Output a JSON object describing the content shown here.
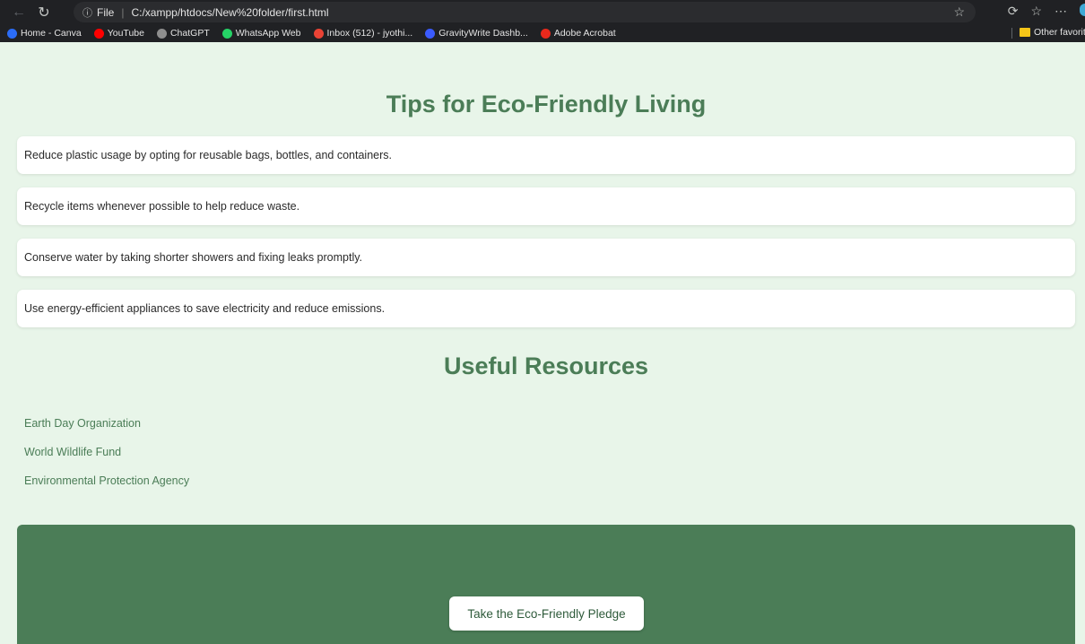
{
  "browser": {
    "file_label": "File",
    "url": "C:/xampp/htdocs/New%20folder/first.html",
    "bookmarks": [
      {
        "label": "Home - Canva",
        "color": "#2b6cf6"
      },
      {
        "label": "YouTube",
        "color": "#ff0000"
      },
      {
        "label": "ChatGPT",
        "color": "#8e8e8e"
      },
      {
        "label": "WhatsApp Web",
        "color": "#25d366"
      },
      {
        "label": "Inbox (512) - jyothi...",
        "color": "#ea4335"
      },
      {
        "label": "GravityWrite Dashb...",
        "color": "#3b5bfd"
      },
      {
        "label": "Adobe Acrobat",
        "color": "#e8291c"
      }
    ],
    "other_favorites": "Other favorit"
  },
  "page": {
    "title": "Tips for Eco-Friendly Living",
    "tips": [
      "Reduce plastic usage by opting for reusable bags, bottles, and containers.",
      "Recycle items whenever possible to help reduce waste.",
      "Conserve water by taking shorter showers and fixing leaks promptly.",
      "Use energy-efficient appliances to save electricity and reduce emissions."
    ],
    "resources_title": "Useful Resources",
    "resources": [
      "Earth Day Organization",
      "World Wildlife Fund",
      "Environmental Protection Agency"
    ],
    "pledge_button": "Take the Eco-Friendly Pledge"
  },
  "colors": {
    "accent_green": "#4b7d57",
    "page_bg": "#e8f5e9"
  }
}
